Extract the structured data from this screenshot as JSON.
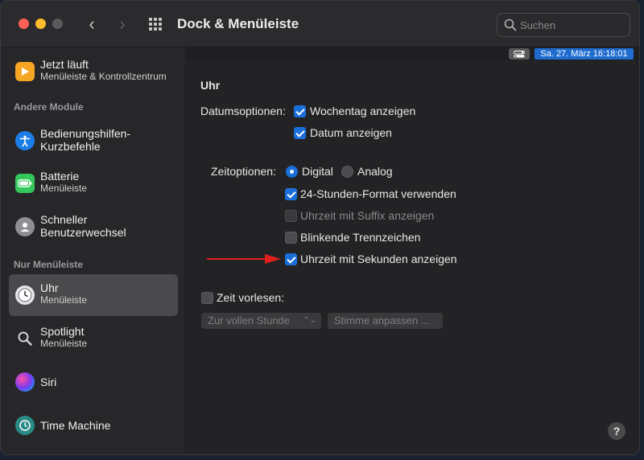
{
  "window": {
    "title": "Dock & Menüleiste",
    "search_placeholder": "Suchen"
  },
  "sidebar": {
    "top_item": {
      "title": "Jetzt läuft",
      "subtitle": "Menüleiste & Kontrollzentrum",
      "icon": "play-icon"
    },
    "section_other": "Andere Module",
    "items_other": [
      {
        "title": "Bedienungshilfen-",
        "subtitle": "Kurzbefehle",
        "icon": "accessibility-icon"
      },
      {
        "title": "Batterie",
        "subtitle": "Menüleiste",
        "icon": "battery-icon"
      },
      {
        "title": "Schneller",
        "subtitle": "Benutzerwechsel",
        "icon": "user-switch-icon"
      }
    ],
    "section_menubar": "Nur Menüleiste",
    "items_menubar": [
      {
        "title": "Uhr",
        "subtitle": "Menüleiste",
        "icon": "clock-icon",
        "selected": true
      },
      {
        "title": "Spotlight",
        "subtitle": "Menüleiste",
        "icon": "magnifier-icon"
      },
      {
        "title": "Siri",
        "subtitle": "",
        "icon": "siri-icon"
      },
      {
        "title": "Time Machine",
        "subtitle": "",
        "icon": "time-machine-icon"
      }
    ]
  },
  "menubar_preview": {
    "clock_text": "Sa. 27. März  16:18:01"
  },
  "clock": {
    "heading": "Uhr",
    "date_options_label": "Datumsoptionen:",
    "show_weekday": {
      "label": "Wochentag anzeigen",
      "checked": true
    },
    "show_date": {
      "label": "Datum anzeigen",
      "checked": true
    },
    "time_options_label": "Zeitoptionen:",
    "radio_digital": {
      "label": "Digital",
      "selected": true
    },
    "radio_analog": {
      "label": "Analog",
      "selected": false
    },
    "use_24h": {
      "label": "24-Stunden-Format verwenden",
      "checked": true
    },
    "show_suffix": {
      "label": "Uhrzeit mit Suffix anzeigen",
      "checked": false,
      "disabled": true
    },
    "flash_separators": {
      "label": "Blinkende Trennzeichen",
      "checked": false
    },
    "show_seconds": {
      "label": "Uhrzeit mit Sekunden anzeigen",
      "checked": true
    },
    "announce_time": {
      "label": "Zeit vorlesen:",
      "checked": false
    },
    "interval_popup": "Zur vollen Stunde",
    "voice_button": "Stimme anpassen ..."
  },
  "help": "?",
  "colors": {
    "accent": "#1a6fdb",
    "arrow": "#e0201a"
  }
}
